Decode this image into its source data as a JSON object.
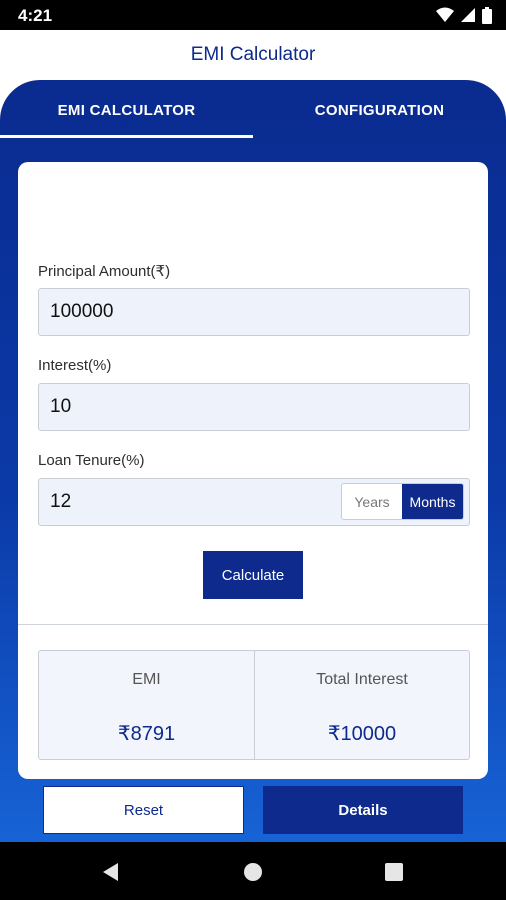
{
  "status_bar": {
    "time": "4:21",
    "icons": [
      "wifi-icon",
      "signal-icon",
      "battery-icon"
    ]
  },
  "app_bar": {
    "title": "EMI Calculator"
  },
  "tabs": [
    {
      "label": "EMI CALCULATOR",
      "selected": true
    },
    {
      "label": "CONFIGURATION",
      "selected": false
    }
  ],
  "form": {
    "principal": {
      "label": "Principal Amount(₹)",
      "value": "100000"
    },
    "interest": {
      "label": "Interest(%)",
      "value": "10"
    },
    "tenure": {
      "label": "Loan Tenure(%)",
      "value": "12",
      "options": [
        "Years",
        "Months"
      ],
      "selected": "Months"
    },
    "calculate_label": "Calculate"
  },
  "results": {
    "emi": {
      "label": "EMI",
      "value": "₹8791"
    },
    "total_interest": {
      "label": "Total Interest",
      "value": "₹10000"
    }
  },
  "actions": {
    "reset_label": "Reset",
    "details_label": "Details"
  },
  "nav": {
    "icons": [
      "back-icon",
      "home-icon",
      "recents-icon"
    ]
  },
  "colors": {
    "primary": "#0d2a8c",
    "gradient_top": "#0a2b8f",
    "gradient_bottom": "#1763d6",
    "field_background": "#eef3fb"
  }
}
